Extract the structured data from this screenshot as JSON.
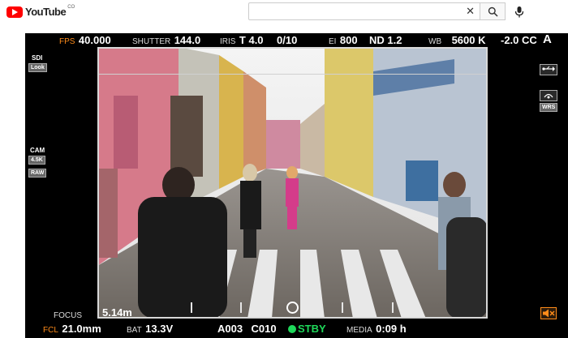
{
  "browser": {
    "logo_text": "YouTube",
    "logo_country": "CO",
    "search_value": "",
    "search_placeholder": "",
    "clear_glyph": "✕",
    "search_glyph": "⌕"
  },
  "hud_top": {
    "fps_label": "FPS",
    "fps_value": "40.000",
    "shutter_label": "SHUTTER",
    "shutter_value": "144.0",
    "iris_label": "IRIS",
    "iris_value": "T 4.0",
    "iris_extra": "0/10",
    "ei_label": "EI",
    "ei_value": "800",
    "nd_value": "ND 1.2",
    "wb_label": "WB",
    "wb_value": "5600 K",
    "cc_value": "-2.0 CC",
    "channel": "A"
  },
  "hud_left": {
    "sdi_label": "SDI",
    "sdi_badge": "Look",
    "cam_label": "CAM",
    "res_badge": "4.5K",
    "codec_badge": "RAW"
  },
  "hud_right": {
    "wrs_badge": "WRS"
  },
  "hud_bottom": {
    "focus_label": "FOCUS",
    "focus_value": "5.14m",
    "fcl_label": "FCL",
    "fcl_value": "21.0mm",
    "bat_label": "BAT",
    "bat_value": "13.3V",
    "reel": "A003",
    "clip": "C010",
    "status": "STBY",
    "media_label": "MEDIA",
    "media_value": "0:09 h"
  },
  "colors": {
    "accent": "#ff8c1a",
    "stby": "#1ed85a",
    "yt_red": "#ff0000"
  }
}
